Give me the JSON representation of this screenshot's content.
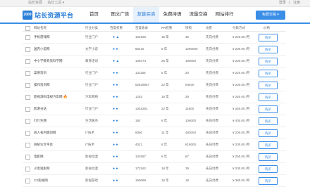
{
  "topbar": {
    "links": [
      "站长资源",
      "站长工具 ▾"
    ],
    "right": [
      "登录",
      "|",
      "注册"
    ]
  },
  "logo": {
    "badge": "2009",
    "text": "站长资源平台"
  },
  "nav": [
    "首页",
    "图文广告",
    "友链买卖",
    "免费持语",
    "流量交换",
    "网站排行"
  ],
  "publish_button": "免费交易 ▾",
  "table": {
    "headers": [
      "网站名称",
      "行业分类",
      "百度权重",
      "百度收录",
      "PR权重",
      "快照",
      "访客",
      "付款方式",
      "价格",
      "操作"
    ],
    "rows": [
      {
        "name": "手机游戏网",
        "category": "行业门户",
        "icons": "● ▲",
        "indexed": "104525",
        "pr": "15 年",
        "snapshot": "35",
        "pay": "先向付费",
        "price": "¥ 240.00 /月",
        "hot": false
      },
      {
        "name": "国内小说网",
        "category": "文学小说",
        "icons": "● ●",
        "indexed": "56415",
        "pr": "6 年",
        "snapshot": "1290000",
        "pay": "先向付费",
        "price": "¥ 200.00 /月",
        "hot": false
      },
      {
        "name": "中小学教育资料学网",
        "category": "教育培训",
        "icons": "● ▲",
        "indexed": "105474",
        "pr": "25 年",
        "snapshot": "190000",
        "pay": "先向付费",
        "price": "¥ 230.00 /月",
        "hot": false
      },
      {
        "name": "案例资讯",
        "category": "行业门户",
        "icons": "● ●",
        "indexed": "131156",
        "pr": "6 年",
        "snapshot": "20",
        "pay": "先向付费",
        "price": "¥ 220.00 /月",
        "hot": false
      },
      {
        "name": "操作资讯网",
        "category": "行业门户",
        "icons": "● ●",
        "indexed": "52819657",
        "pr": "22 年",
        "snapshot": "94400",
        "pay": "先向付费",
        "price": "¥ 230.00 /月",
        "hot": false
      },
      {
        "name": "影视源码电视汽车网",
        "category": "汽车网络",
        "icons": "● ●",
        "indexed": "1253",
        "pr": "16 年",
        "snapshot": "28",
        "pay": "先向付费",
        "price": "¥ 250.00 /月",
        "hot": true
      },
      {
        "name": "影游分站",
        "category": "行业门户",
        "icons": "● ●",
        "indexed": "1345281",
        "pr": "22 年",
        "snapshot": "11600",
        "pay": "先向付费",
        "price": "¥ 250.00 /月",
        "hot": false
      },
      {
        "name": "叮叮生网",
        "category": "生活服务",
        "icons": "● ●",
        "indexed": "192",
        "pr": "6 年",
        "snapshot": "106000",
        "pay": "先向付费",
        "price": "¥ 400.00 /月",
        "hot": false
      },
      {
        "name": "商人名利端创网",
        "category": "IT技术",
        "icons": "● ●",
        "indexed": "8060",
        "pr": "11 年",
        "snapshot": "483000",
        "pay": "先向付费",
        "price": "¥ 200.00 /月",
        "hot": false
      },
      {
        "name": "商统论文平台",
        "category": "IT技术",
        "icons": "● ●",
        "indexed": "4021",
        "pr": "6 年",
        "snapshot": "619000",
        "pay": "先向付费",
        "price": "¥ 200.00 /月",
        "hot": false
      },
      {
        "name": "电影网",
        "category": "影视动漫",
        "icons": "● ●",
        "indexed": "102587",
        "pr": "6 年",
        "snapshot": "67",
        "pay": "先向付费",
        "price": "¥ 250.00 /月",
        "hot": false
      },
      {
        "name": "小黑观影网",
        "category": "影视动漫",
        "icons": "● ●",
        "indexed": "173162",
        "pr": "18 年",
        "snapshot": "29",
        "pay": "先向付费",
        "price": "¥ 200.00 /月",
        "hot": false
      },
      {
        "name": "CX影视网",
        "category": "影视游戏",
        "icons": "● ●",
        "indexed": "159089",
        "pr": "15 年",
        "snapshot": "18",
        "pay": "先向付费",
        "price": "¥ 380.00 /月",
        "hot": false
      }
    ],
    "buy_label": "购买"
  }
}
